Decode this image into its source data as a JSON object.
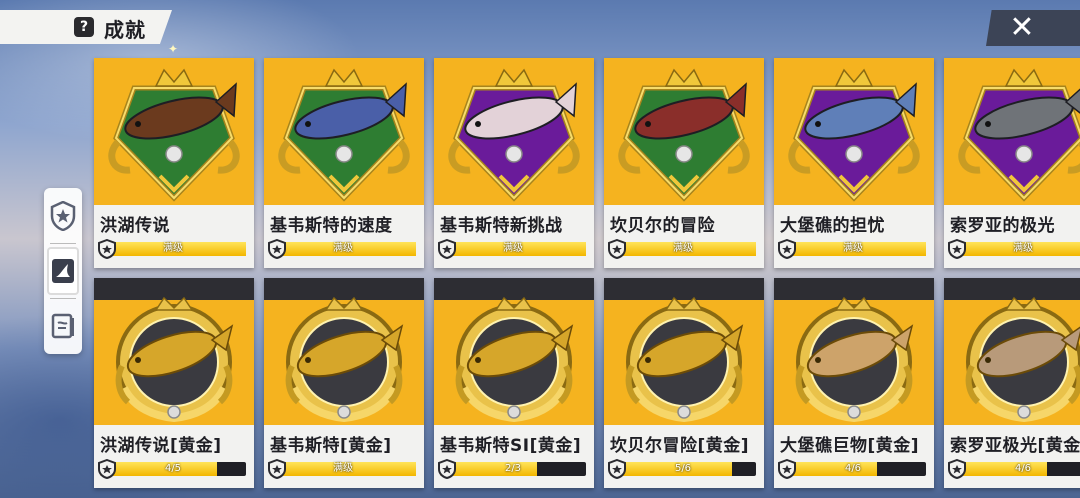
{
  "header": {
    "title": "成就",
    "help_label": "?",
    "close_label": "✕"
  },
  "side_tabs": [
    {
      "name": "star-badge",
      "active": false
    },
    {
      "name": "fish",
      "active": true
    },
    {
      "name": "book",
      "active": false
    }
  ],
  "cards": [
    {
      "name": "洪湖传说",
      "progress_text": "满级",
      "progress": 1.0,
      "tier": "normal",
      "fish_color": "#6b3a1e",
      "bg_color": "#2e7d32"
    },
    {
      "name": "基韦斯特的速度",
      "progress_text": "满级",
      "progress": 1.0,
      "tier": "normal",
      "fish_color": "#4a5fa8",
      "bg_color": "#2e7d32"
    },
    {
      "name": "基韦斯特新挑战",
      "progress_text": "满级",
      "progress": 1.0,
      "tier": "normal",
      "fish_color": "#e3d2d8",
      "bg_color": "#6a1b9a"
    },
    {
      "name": "坎贝尔的冒险",
      "progress_text": "满级",
      "progress": 1.0,
      "tier": "normal",
      "fish_color": "#8a2e2a",
      "bg_color": "#2e7d32"
    },
    {
      "name": "大堡礁的担忧",
      "progress_text": "满级",
      "progress": 1.0,
      "tier": "normal",
      "fish_color": "#5f7fb8",
      "bg_color": "#6a1b9a"
    },
    {
      "name": "索罗亚的极光",
      "progress_text": "满级",
      "progress": 1.0,
      "tier": "normal",
      "fish_color": "#6f7378",
      "bg_color": "#6a1b9a"
    },
    {
      "name": "洪湖传说[黄金]",
      "progress_text": "4/5",
      "progress": 0.8,
      "tier": "gold",
      "fish_color": "#d6a62a",
      "bg_color": "#3a3a40"
    },
    {
      "name": "基韦斯特[黄金]",
      "progress_text": "满级",
      "progress": 1.0,
      "tier": "gold",
      "fish_color": "#d6a62a",
      "bg_color": "#3a3a40"
    },
    {
      "name": "基韦斯特SI[黄金]",
      "progress_text": "2/3",
      "progress": 0.667,
      "tier": "gold",
      "fish_color": "#d6a62a",
      "bg_color": "#3a3a40"
    },
    {
      "name": "坎贝尔冒险[黄金]",
      "progress_text": "5/6",
      "progress": 0.833,
      "tier": "gold",
      "fish_color": "#d6a62a",
      "bg_color": "#3a3a40"
    },
    {
      "name": "大堡礁巨物[黄金]",
      "progress_text": "4/6",
      "progress": 0.667,
      "tier": "gold",
      "fish_color": "#cda36a",
      "bg_color": "#3a3a40"
    },
    {
      "name": "索罗亚极光[黄金]",
      "progress_text": "4/6",
      "progress": 0.667,
      "tier": "gold",
      "fish_color": "#b89a7a",
      "bg_color": "#3a3a40"
    }
  ]
}
